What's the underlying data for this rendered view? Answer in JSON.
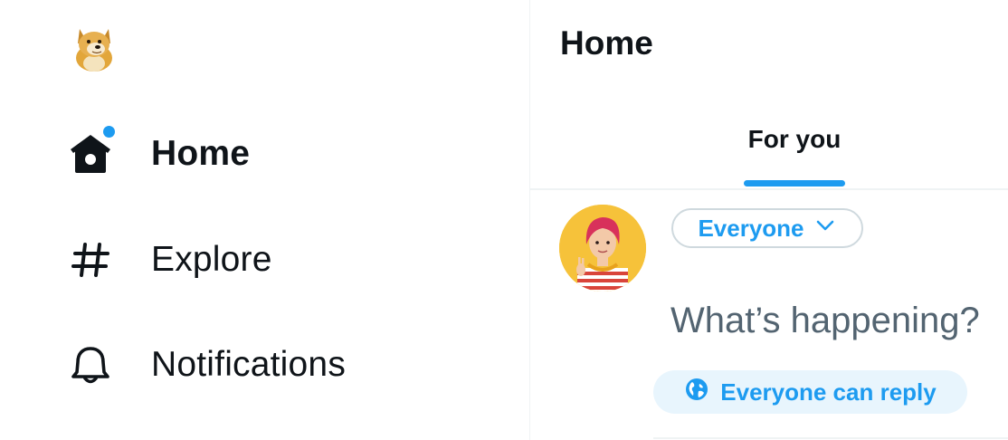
{
  "sidebar": {
    "logo_icon": "doge-logo-icon",
    "items": [
      {
        "label": "Home",
        "icon": "home-icon",
        "active": true,
        "has_notification_dot": true
      },
      {
        "label": "Explore",
        "icon": "hashtag-icon",
        "active": false
      },
      {
        "label": "Notifications",
        "icon": "bell-icon",
        "active": false
      }
    ]
  },
  "header": {
    "title": "Home",
    "tabs": [
      {
        "label": "For you",
        "selected": true
      }
    ]
  },
  "composer": {
    "audience_label": "Everyone",
    "placeholder": "What’s happening?",
    "reply_setting_label": "Everyone can reply"
  },
  "colors": {
    "accent": "#1d9bf0",
    "text_primary": "#0f1419",
    "text_secondary": "#536471",
    "divider": "#eff3f4",
    "reply_pill_bg": "#e8f5fd"
  }
}
